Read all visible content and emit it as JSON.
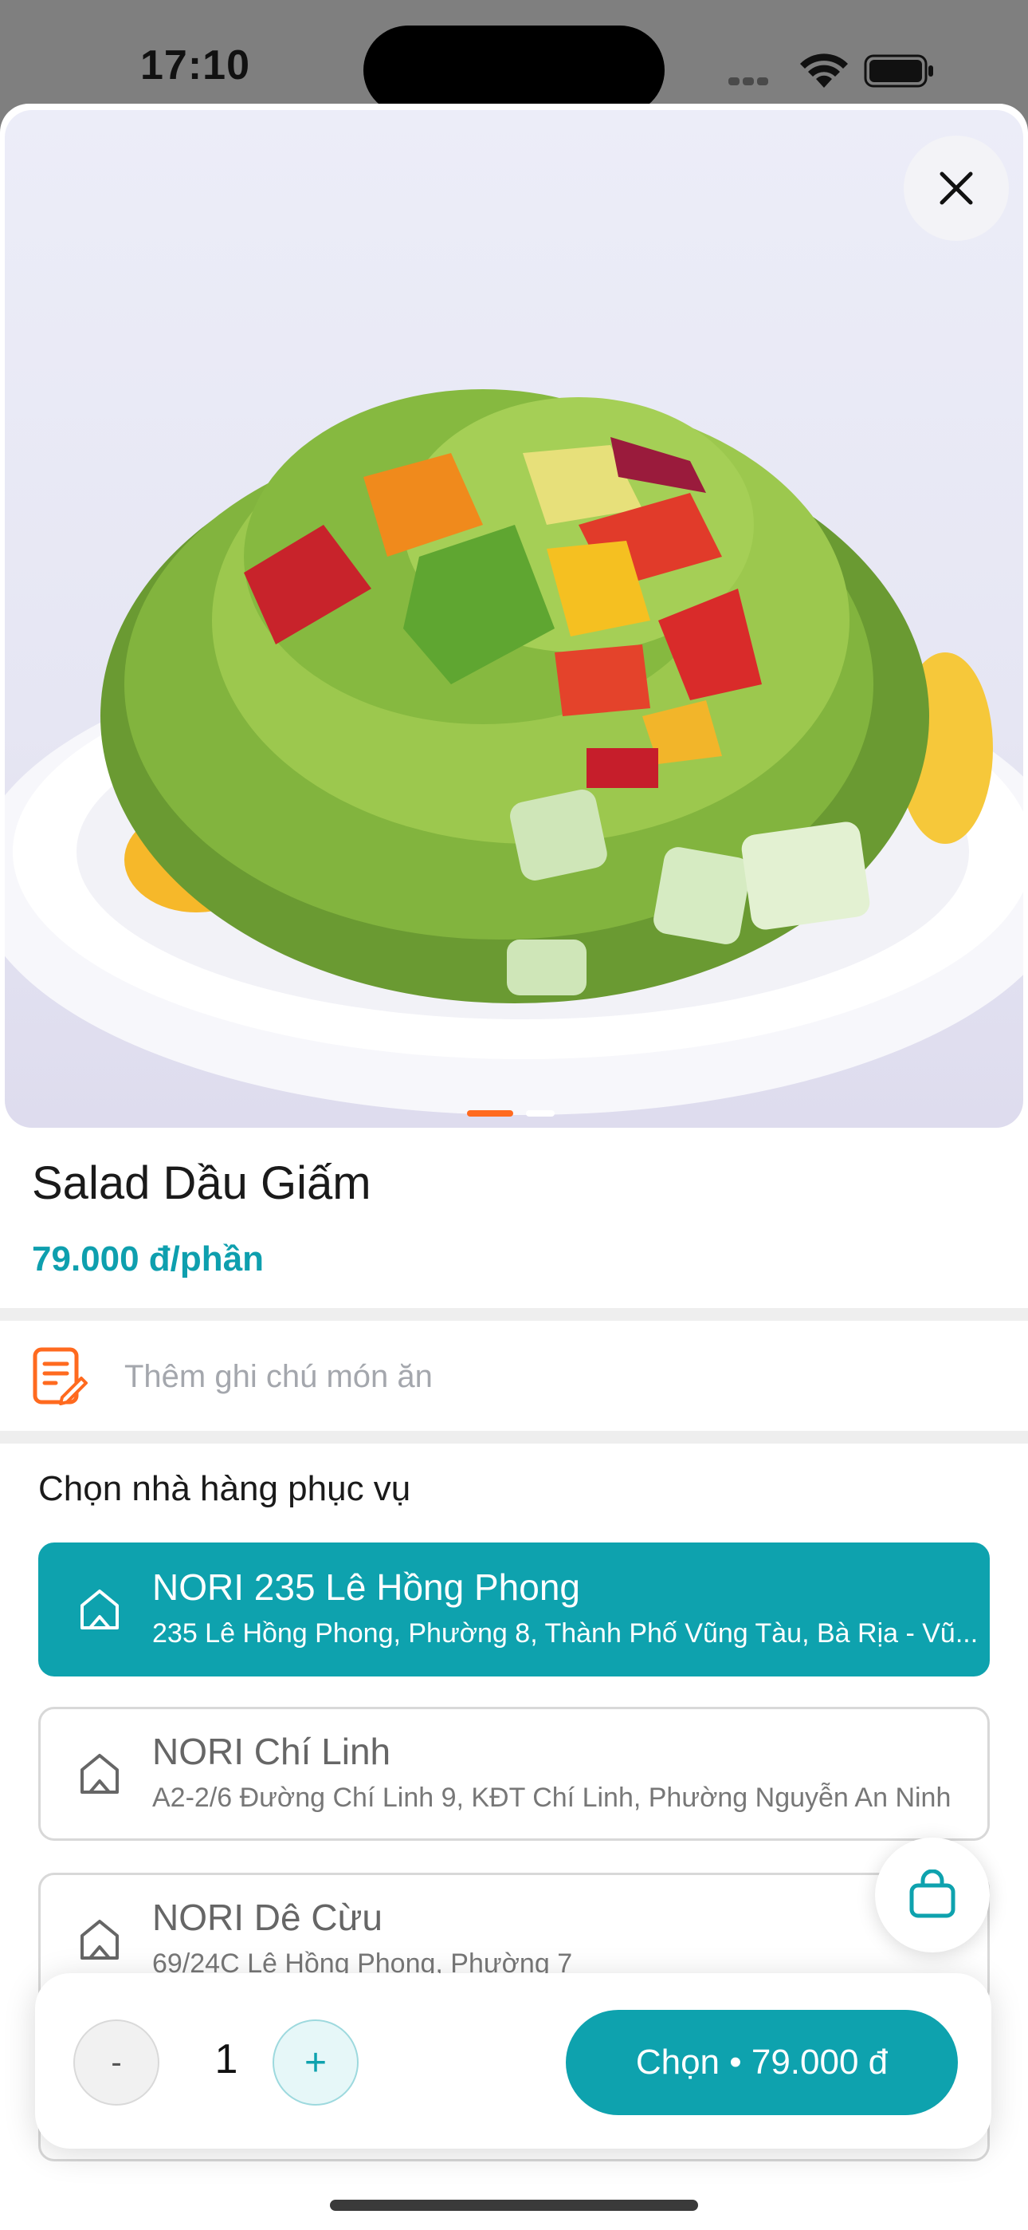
{
  "status_bar": {
    "time": "17:10"
  },
  "product": {
    "name": "Salad Dầu Giấm",
    "price": "79.000 đ/phần",
    "image_alt": "salad-photo",
    "carousel": {
      "count": 2,
      "active_index": 0
    }
  },
  "note": {
    "placeholder": "Thêm ghi chú món ăn"
  },
  "stores": {
    "title": "Chọn nhà hàng phục vụ",
    "items": [
      {
        "name": "NORI 235 Lê Hồng Phong",
        "address": "235 Lê Hồng Phong, Phường 8, Thành Phố Vũng Tàu, Bà Rịa - Vũ...",
        "selected": true
      },
      {
        "name": "NORI Chí Linh",
        "address": "A2-2/6 Đường Chí Linh 9, KĐT Chí Linh, Phường Nguyễn An Ninh",
        "selected": false
      },
      {
        "name": "NORI Dê Cừu",
        "address": "69/24C Lê Hồng Phong, Phường 7",
        "selected": false
      }
    ]
  },
  "cart": {
    "quantity": "1",
    "minus_label": "-",
    "plus_label": "+",
    "choose_label": "Chọn • 79.000 đ"
  },
  "colors": {
    "accent": "#0ea2ae",
    "orange": "#ff6a1f"
  },
  "icons": [
    "close-icon",
    "note-edit-icon",
    "store-location-icon",
    "shopping-bag-icon",
    "wifi-icon",
    "battery-icon",
    "signal-icon"
  ]
}
